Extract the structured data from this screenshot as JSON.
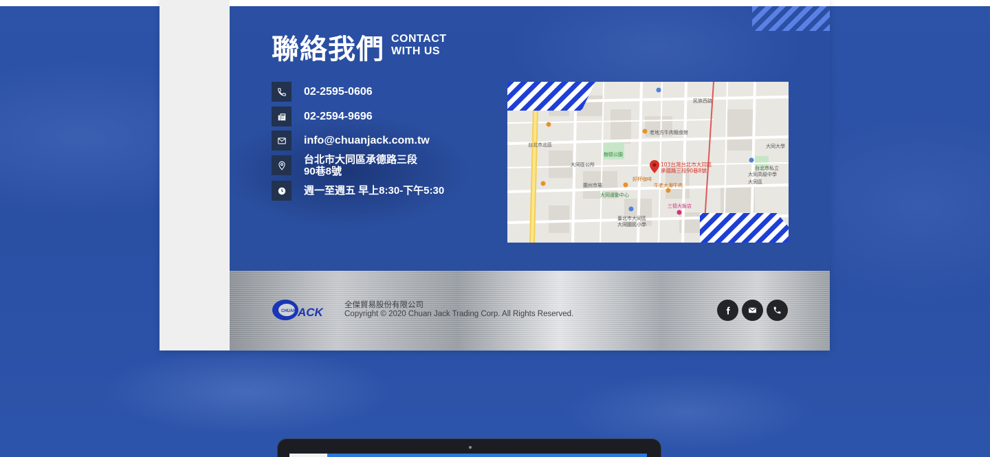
{
  "contact": {
    "title_zh": "聯絡我們",
    "title_en_line1": "CONTACT",
    "title_en_line2": "WITH US",
    "phone": "02-2595-0606",
    "fax": "02-2594-9696",
    "email": "info@chuanjack.com.tw",
    "address_line1": "台北市大同區承德路三段",
    "address_line2": "90巷8號",
    "hours": "週一至週五 早上8:30-下午5:30",
    "icons": [
      "phone-icon",
      "fax-icon",
      "mail-icon",
      "location-pin-icon",
      "clock-icon"
    ]
  },
  "map": {
    "pin_label_line1": "103台灣台北市大同區",
    "pin_label_line2": "承德路三段90巷8號",
    "places": [
      "大同區公所",
      "大同運動中心",
      "臺北市大同區",
      "大同國民小學",
      "大同大學",
      "台北市私立",
      "大同高級中學",
      "三德大飯店",
      "樹德公園",
      "蘭州市場",
      "老地方牛肉麵食館",
      "牛老大潮牛肉",
      "好杯咖啡",
      "民族西路",
      "台北市北區",
      "大同區"
    ]
  },
  "footer": {
    "logo_text": "ACK",
    "logo_small": "CHUAN",
    "company_name": "全傑貿易股份有限公司",
    "copyright": "Copyright © 2020 Chuan Jack Trading Corp. All Rights Reserved.",
    "social": [
      "facebook-icon",
      "mail-icon",
      "phone-icon"
    ]
  },
  "colors": {
    "background_blue": "#2b51a6",
    "icon_box": "#22324f",
    "stripe_blue": "#1e3fd6",
    "social_dark": "#232427",
    "map_pin": "#d83228"
  }
}
